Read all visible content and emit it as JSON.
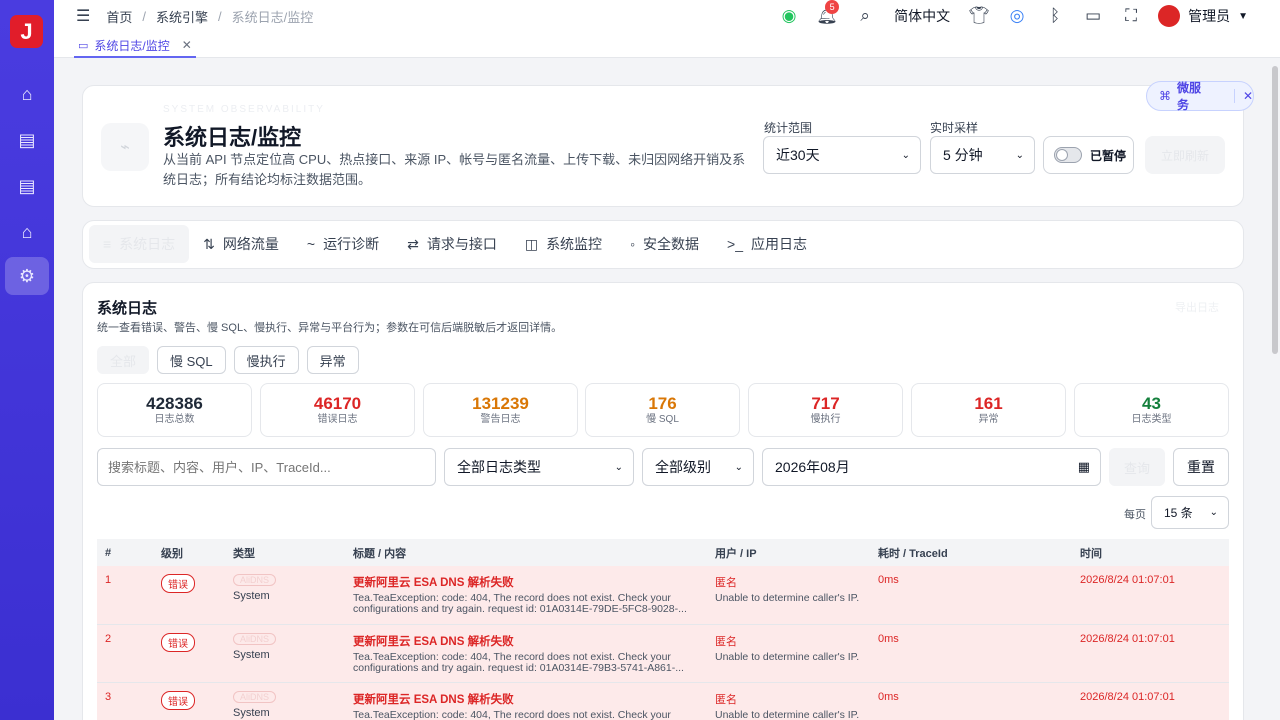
{
  "app": {
    "logo_text": "J"
  },
  "breadcrumb": {
    "home": "首页",
    "engine": "系统引擎",
    "current": "系统日志/监控"
  },
  "topbar": {
    "notif_count": "5",
    "language": "简体中文",
    "user": "管理员"
  },
  "tab": {
    "label": "系统日志/监控"
  },
  "header": {
    "ghost_label": "SYSTEM OBSERVABILITY",
    "title": "系统日志/监控",
    "desc": "从当前 API 节点定位高 CPU、热点接口、来源 IP、帐号与匿名流量、上传下载、未归因网络开销及系统日志；所有结论均标注数据范围。",
    "range_label": "统计范围",
    "range_value": "近30天",
    "sample_label": "实时采样",
    "sample_value": "5 分钟",
    "toggle_label": "已暂停",
    "refresh_button": "立即刷新",
    "micro_label": "微服务"
  },
  "nav_tabs": [
    {
      "label": "系统日志",
      "icon": "≡"
    },
    {
      "label": "网络流量",
      "icon": "⇅"
    },
    {
      "label": "运行诊断",
      "icon": "~"
    },
    {
      "label": "请求与接口",
      "icon": "⇄"
    },
    {
      "label": "系统监控",
      "icon": "◫"
    },
    {
      "label": "安全数据",
      "icon": "◦"
    },
    {
      "label": "应用日志",
      "icon": ">_"
    }
  ],
  "logs": {
    "title": "系统日志",
    "desc": "统一查看错误、警告、慢 SQL、慢执行、异常与平台行为；参数在可信后端脱敏后才返回详情。",
    "export_label": "导出日志",
    "filters": [
      "全部",
      "慢 SQL",
      "慢执行",
      "异常"
    ]
  },
  "stats": [
    {
      "value": "428386",
      "label": "日志总数",
      "color": "#111827"
    },
    {
      "value": "46170",
      "label": "错误日志",
      "color": "#dc2626"
    },
    {
      "value": "131239",
      "label": "警告日志",
      "color": "#d97706"
    },
    {
      "value": "176",
      "label": "慢 SQL",
      "color": "#d97706"
    },
    {
      "value": "717",
      "label": "慢执行",
      "color": "#dc2626"
    },
    {
      "value": "161",
      "label": "异常",
      "color": "#dc2626"
    },
    {
      "value": "43",
      "label": "日志类型",
      "color": "#15803d"
    }
  ],
  "search": {
    "placeholder": "搜索标题、内容、用户、IP、TraceId...",
    "type_value": "全部日志类型",
    "level_value": "全部级别",
    "month_value": "2026年08月",
    "query_button": "查询",
    "reset_button": "重置",
    "per_page_label": "每页",
    "per_page_value": "15 条"
  },
  "table": {
    "headers": [
      "#",
      "级别",
      "类型",
      "标题 / 内容",
      "用户 / IP",
      "耗时 / TraceId",
      "时间"
    ],
    "rows": [
      {
        "no": "1",
        "level": "错误",
        "tag": "AliDNS",
        "type": "System",
        "title": "更新阿里云 ESA DNS 解析失败",
        "content": "Tea.TeaException: code: 404, The record does not exist. Check your configurations and try again. request id: 01A0314E-79DE-5FC8-9028-...",
        "user": "匿名",
        "ip": "Unable to determine caller's IP.",
        "duration": "0ms",
        "time": "2026/8/24 01:07:01"
      },
      {
        "no": "2",
        "level": "错误",
        "tag": "AliDNS",
        "type": "System",
        "title": "更新阿里云 ESA DNS 解析失败",
        "content": "Tea.TeaException: code: 404, The record does not exist. Check your configurations and try again. request id: 01A0314E-79B3-5741-A861-...",
        "user": "匿名",
        "ip": "Unable to determine caller's IP.",
        "duration": "0ms",
        "time": "2026/8/24 01:07:01"
      },
      {
        "no": "3",
        "level": "错误",
        "tag": "AliDNS",
        "type": "System",
        "title": "更新阿里云 ESA DNS 解析失败",
        "content": "Tea.TeaException: code: 404, The record does not exist. Check your",
        "user": "匿名",
        "ip": "Unable to determine caller's IP.",
        "duration": "0ms",
        "time": "2026/8/24 01:07:01"
      }
    ]
  }
}
